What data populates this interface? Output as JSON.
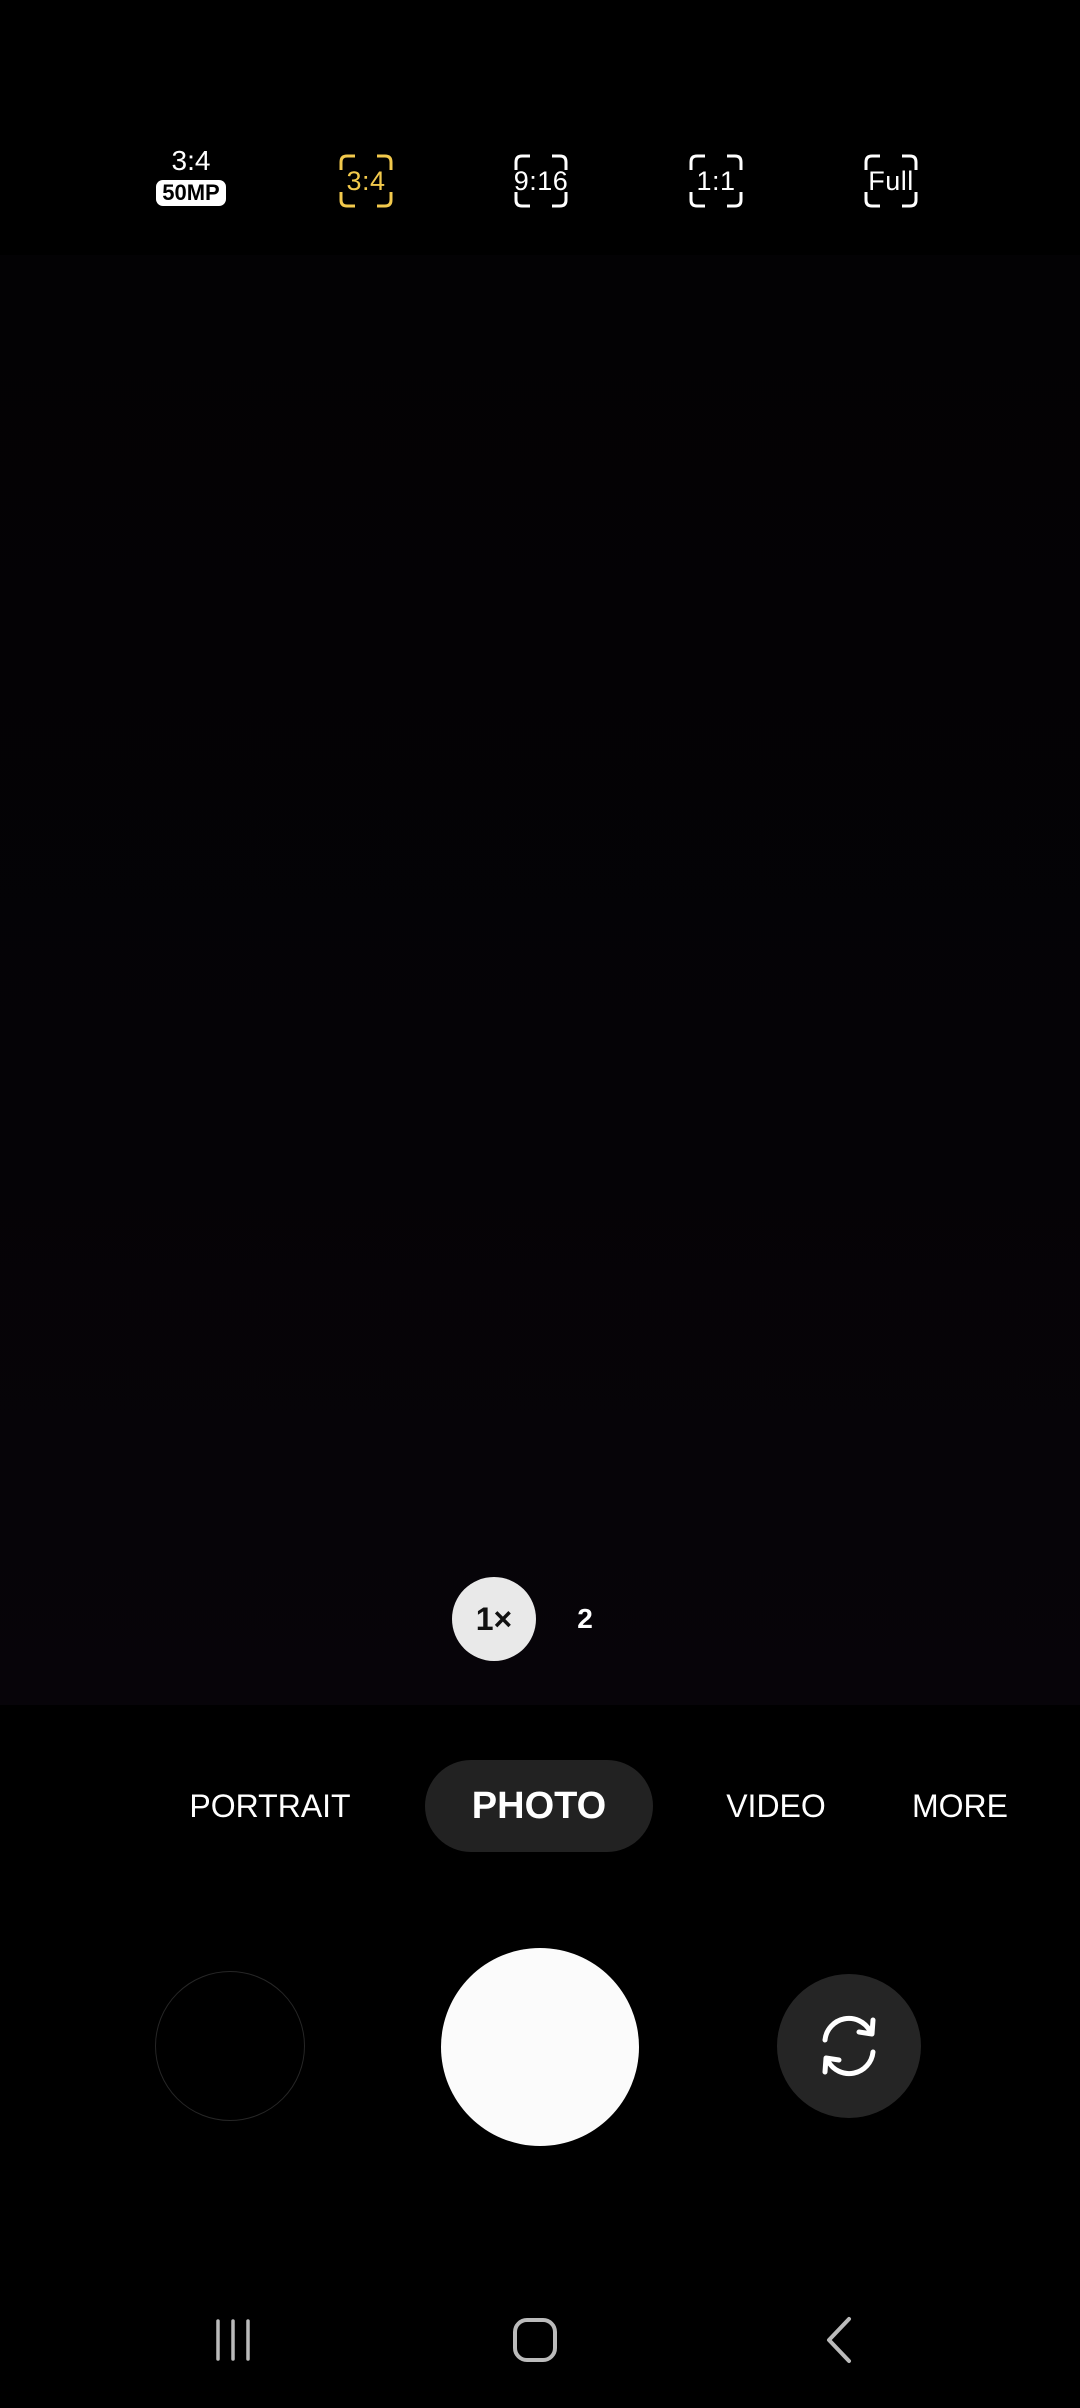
{
  "aspect_ratios": {
    "options": [
      {
        "label": "3:4",
        "badge": "50MP",
        "selected": false
      },
      {
        "label": "3:4",
        "selected": true
      },
      {
        "label": "9:16",
        "selected": false
      },
      {
        "label": "1:1",
        "selected": false
      },
      {
        "label": "Full",
        "selected": false
      }
    ],
    "selected_color": "#f2c94c"
  },
  "zoom": {
    "active_label": "1×",
    "other_label": "2"
  },
  "modes": {
    "items": [
      "PORTRAIT",
      "PHOTO",
      "VIDEO",
      "MORE"
    ],
    "selected": "PHOTO"
  },
  "controls": {
    "gallery": "gallery-thumbnail",
    "shutter": "shutter-button",
    "switch_camera": "switch-camera-icon"
  },
  "navigation": {
    "recents": "recents-icon",
    "home": "home-icon",
    "back": "back-icon"
  }
}
